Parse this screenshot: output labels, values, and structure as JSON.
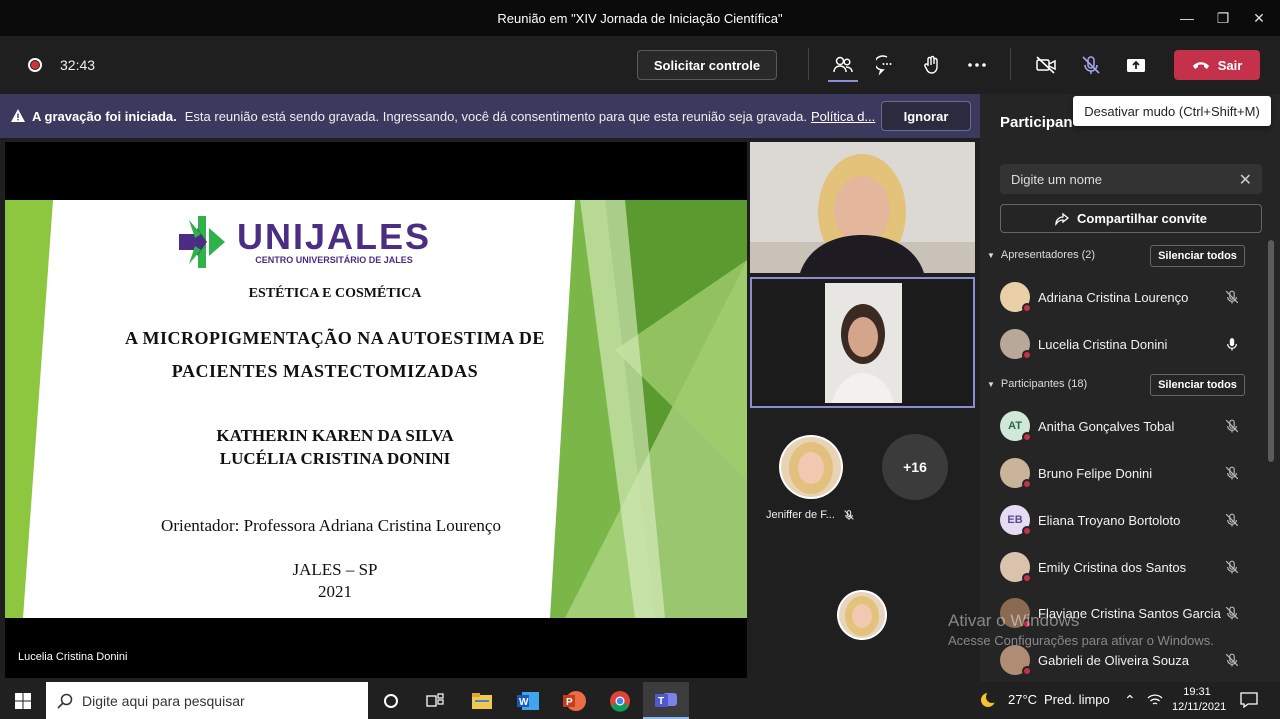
{
  "window": {
    "title": "Reunião em \"XIV Jornada de Iniciação Científica\""
  },
  "toolbar": {
    "timer": "32:43",
    "request_control": "Solicitar controle",
    "leave_label": "Sair",
    "mute_tooltip": "Desativar mudo (Ctrl+Shift+M)"
  },
  "banner": {
    "title": "A gravação foi iniciada.",
    "text": "Esta reunião está sendo gravada. Ingressando, você dá consentimento para que esta reunião seja gravada.",
    "link": "Política d...",
    "dismiss": "Ignorar"
  },
  "slide": {
    "logo_name": "UNIJALES",
    "logo_subtitle": "CENTRO UNIVERSITÁRIO DE JALES",
    "course": "ESTÉTICA E COSMÉTICA",
    "title_line1": "A MICROPIGMENTAÇÃO NA AUTOESTIMA DE",
    "title_line2": "PACIENTES MASTECTOMIZADAS",
    "author1": "KATHERIN KAREN DA SILVA",
    "author2": "LUCÉLIA CRISTINA DONINI",
    "advisor": "Orientador: Professora Adriana Cristina Lourenço",
    "city": "JALES – SP",
    "year": "2021"
  },
  "stage": {
    "presenter_name": "Lucelia Cristina Donini"
  },
  "video": {
    "small_tile_name": "Jeniffer de F...",
    "overflow_count": "+16"
  },
  "panel": {
    "title": "Participan",
    "search_placeholder": "Digite um nome",
    "share_invite": "Compartilhar convite",
    "presenters_label": "Apresentadores (2)",
    "participants_label": "Participantes (18)",
    "mute_all": "Silenciar todos",
    "presenters": [
      {
        "name": "Adriana Cristina Lourenço",
        "mic": "muted"
      },
      {
        "name": "Lucelia Cristina Donini",
        "mic": "on"
      }
    ],
    "participants": [
      {
        "name": "Anitha Gonçalves Tobal",
        "initials": "AT"
      },
      {
        "name": "Bruno Felipe Donini",
        "initials": ""
      },
      {
        "name": "Eliana Troyano Bortoloto",
        "initials": "EB"
      },
      {
        "name": "Emily Cristina dos Santos",
        "initials": ""
      },
      {
        "name": "Flaviane Cristina Santos Garcia",
        "initials": ""
      },
      {
        "name": "Gabrieli de Oliveira Souza",
        "initials": ""
      }
    ]
  },
  "watermark": {
    "line1": "Ativar o Windows",
    "line2": "Acesse Configurações para ativar o Windows."
  },
  "taskbar": {
    "search_placeholder": "Digite aqui para pesquisar",
    "temperature": "27°C",
    "weather": "Pred. limpo",
    "time": "19:31",
    "date": "12/11/2021"
  },
  "colors": {
    "leave": "#c4314b",
    "banner": "#3b3a5e",
    "accent": "#8b8bd6",
    "logo_purple": "#4b2e83",
    "logo_green": "#2eb34a"
  }
}
